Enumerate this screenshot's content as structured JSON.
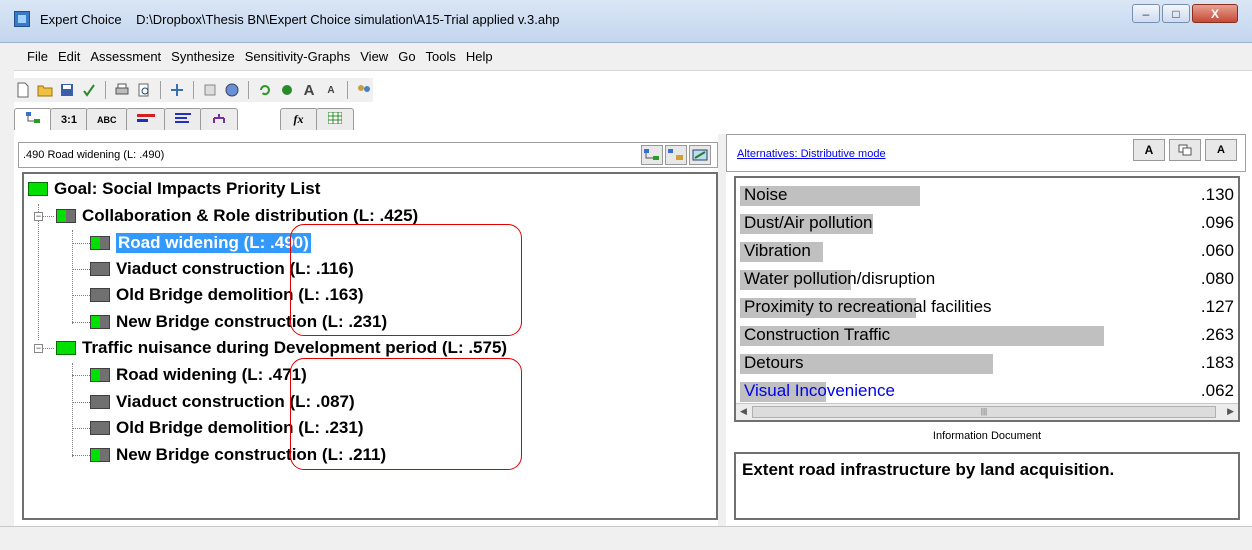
{
  "window": {
    "app_name": "Expert Choice",
    "file_path": "D:\\Dropbox\\Thesis BN\\Expert Choice simulation\\A15-Trial applied v.3.ahp",
    "controls": {
      "minimize": "–",
      "maximize": "□",
      "close": "X"
    }
  },
  "menu": [
    "File",
    "Edit",
    "Assessment",
    "Synthesize",
    "Sensitivity-Graphs",
    "View",
    "Go",
    "Tools",
    "Help"
  ],
  "toolbar_icons": [
    "new-file-icon",
    "open-folder-icon",
    "save-icon",
    "check-icon",
    "print-icon",
    "print-preview-icon",
    "move-icon",
    "edit-icon",
    "globe-icon",
    "refresh-icon",
    "refresh-all-icon",
    "font-larger-icon",
    "font-smaller-icon",
    "users-icon"
  ],
  "tabs": [
    {
      "label": "",
      "icon": "tree-view-icon"
    },
    {
      "label": "3:1"
    },
    {
      "label": "ABC"
    },
    {
      "label": "",
      "icon": "bars-icon"
    },
    {
      "label": "",
      "icon": "lines-icon"
    },
    {
      "label": "",
      "icon": "hierarchy-icon"
    },
    {
      "label": "",
      "icon": "formula-icon"
    },
    {
      "label": "",
      "icon": "grid-icon"
    }
  ],
  "left_panel": {
    "status": ".490  Road widening (L: .490)"
  },
  "tree": {
    "goal": "Goal: Social Impacts Priority List",
    "groups": [
      {
        "label": "Collaboration & Role distribution (L: .425)",
        "items": [
          {
            "name": "Road widening",
            "local": "(L: .490)",
            "selected": true
          },
          {
            "name": "Viaduct construction",
            "local": "(L: .116)"
          },
          {
            "name": "Old Bridge demolition",
            "local": "(L: .163)"
          },
          {
            "name": "New Bridge construction",
            "local": "(L: .231)"
          }
        ]
      },
      {
        "label": "Traffic nuisance during Development period (L: .575)",
        "items": [
          {
            "name": "Road widening",
            "local": "(L: .471)"
          },
          {
            "name": "Viaduct construction",
            "local": "(L: .087)"
          },
          {
            "name": "Old Bridge demolition",
            "local": "(L: .231)"
          },
          {
            "name": "New Bridge construction",
            "local": "(L: .211)"
          }
        ]
      }
    ]
  },
  "right_panel": {
    "mode_link": "Alternatives: Distributive mode",
    "alternatives": [
      {
        "name": "Noise",
        "value": ".130",
        "priority": 0.13
      },
      {
        "name": "Dust/Air pollution",
        "value": ".096",
        "priority": 0.096
      },
      {
        "name": "Vibration",
        "value": ".060",
        "priority": 0.06
      },
      {
        "name": "Water pollution/disruption",
        "value": ".080",
        "priority": 0.08
      },
      {
        "name": "Proximity to recreational facilities",
        "value": ".127",
        "priority": 0.127
      },
      {
        "name": "Construction Traffic",
        "value": ".263",
        "priority": 0.263
      },
      {
        "name": "Detours",
        "value": ".183",
        "priority": 0.183
      },
      {
        "name": "Visual Incovenience",
        "value": ".062",
        "priority": 0.062
      }
    ],
    "info_title": "Information Document",
    "info_text": "Extent road infrastructure by land acquisition."
  },
  "colors": {
    "goal_green": "#00e000",
    "node_grey": "#707070",
    "selection": "#3399ff",
    "annotation_red": "#e00000",
    "bar_grey": "#c0c0c0"
  }
}
